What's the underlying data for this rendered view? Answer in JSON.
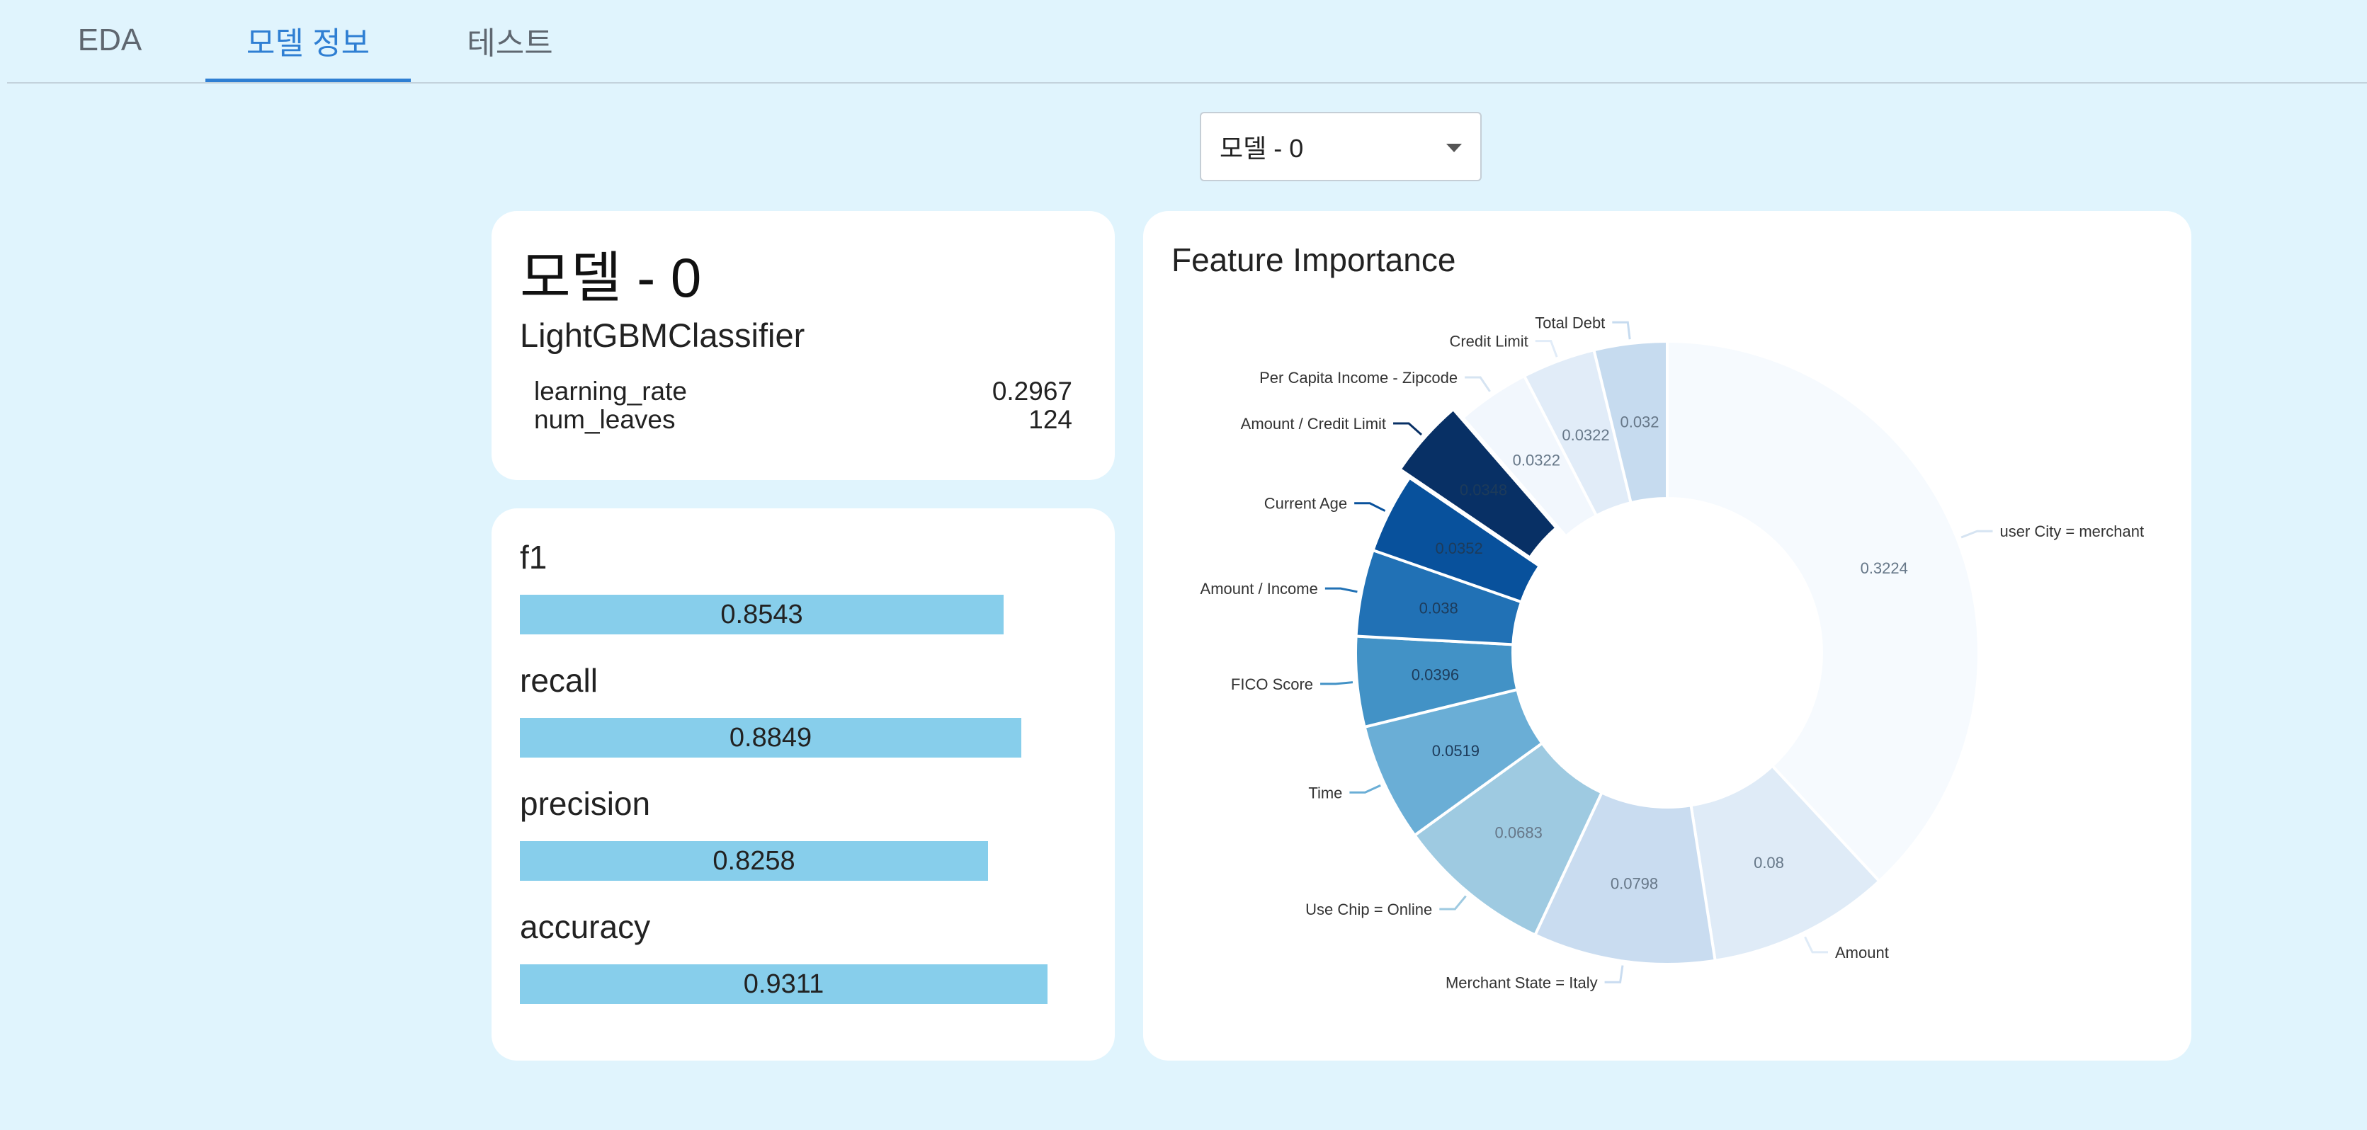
{
  "tabs": [
    {
      "label": "EDA",
      "active": false
    },
    {
      "label": "모델 정보",
      "active": true
    },
    {
      "label": "테스트",
      "active": false
    }
  ],
  "model_select": {
    "value": "모델 - 0"
  },
  "model_info": {
    "title": "모델 - 0",
    "classifier": "LightGBMClassifier",
    "params": [
      {
        "name": "learning_rate",
        "value": "0.2967"
      },
      {
        "name": "num_leaves",
        "value": "124"
      }
    ]
  },
  "metrics": [
    {
      "name": "f1",
      "value": 0.8543,
      "label": "0.8543"
    },
    {
      "name": "recall",
      "value": 0.8849,
      "label": "0.8849"
    },
    {
      "name": "precision",
      "value": 0.8258,
      "label": "0.8258"
    },
    {
      "name": "accuracy",
      "value": 0.9311,
      "label": "0.9311"
    }
  ],
  "colors": {
    "background": "#e0f4fd",
    "accent": "#2f7fd3",
    "metric_bar": "#87ceeb"
  },
  "chart_data": {
    "type": "pie",
    "title": "Feature Importance",
    "donut": true,
    "categories": [
      "user City = merchant",
      "Amount",
      "Merchant State = Italy",
      "Use Chip = Online",
      "Time",
      "FICO Score",
      "Amount / Income",
      "Current Age",
      "Amount / Credit Limit",
      "Per Capita Income - Zipcode",
      "Credit Limit",
      "Total Debt"
    ],
    "values": [
      0.3224,
      0.08,
      0.0798,
      0.0683,
      0.0519,
      0.0396,
      0.038,
      0.0352,
      0.0348,
      0.0322,
      0.0322,
      0.032
    ],
    "value_labels": [
      "0.3224",
      "0.08",
      "0.0798",
      "0.0683",
      "0.0519",
      "0.0396",
      "0.038",
      "0.0352",
      "0.0348",
      "0.0322",
      "0.0322",
      "0.032"
    ],
    "colors": [
      "#f6fafe",
      "#dfebf7",
      "#c9dcf0",
      "#9ecae1",
      "#6aaed6",
      "#4292c6",
      "#2171b5",
      "#08519c",
      "#083065",
      "#f2f7fd",
      "#e1ecf8",
      "#c6dbef"
    ],
    "exploded": [
      false,
      false,
      false,
      false,
      false,
      false,
      false,
      false,
      true,
      false,
      false,
      false
    ]
  }
}
